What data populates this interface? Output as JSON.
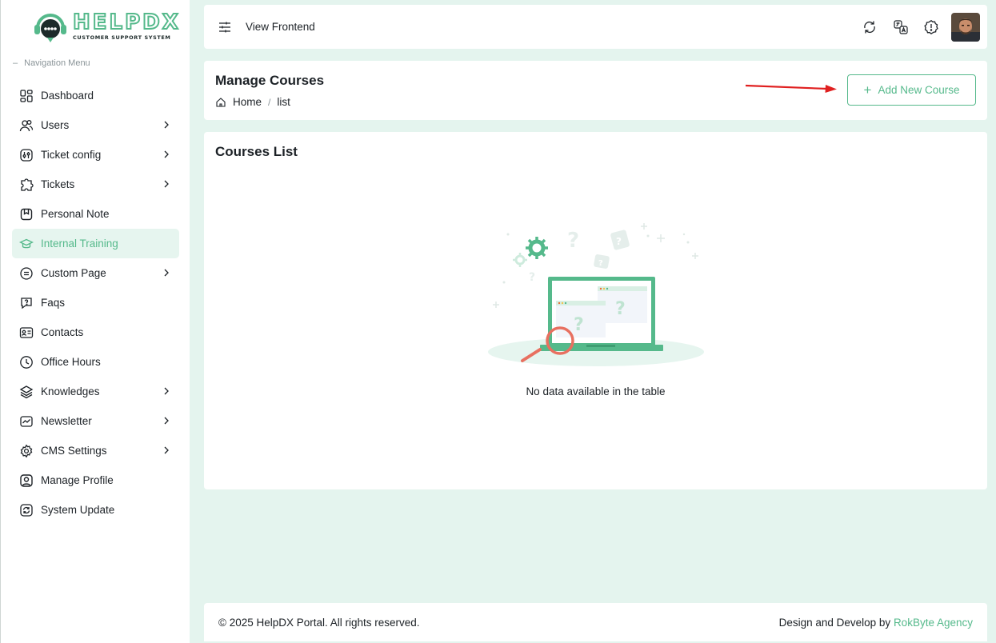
{
  "brand": {
    "name": "HELPDX",
    "tagline": "CUSTOMER SUPPORT SYSTEM",
    "accent_color": "#55b98b"
  },
  "sidebar": {
    "heading": "Navigation Menu",
    "items": [
      {
        "label": "Dashboard",
        "icon": "dashboard-icon",
        "has_submenu": false,
        "active": false
      },
      {
        "label": "Users",
        "icon": "users-icon",
        "has_submenu": true,
        "active": false
      },
      {
        "label": "Ticket config",
        "icon": "ticket-config-icon",
        "has_submenu": true,
        "active": false
      },
      {
        "label": "Tickets",
        "icon": "tickets-icon",
        "has_submenu": true,
        "active": false
      },
      {
        "label": "Personal Note",
        "icon": "note-icon",
        "has_submenu": false,
        "active": false
      },
      {
        "label": "Internal Training",
        "icon": "graduation-cap-icon",
        "has_submenu": false,
        "active": true
      },
      {
        "label": "Custom Page",
        "icon": "page-icon",
        "has_submenu": true,
        "active": false
      },
      {
        "label": "Faqs",
        "icon": "faq-icon",
        "has_submenu": false,
        "active": false
      },
      {
        "label": "Contacts",
        "icon": "contacts-icon",
        "has_submenu": false,
        "active": false
      },
      {
        "label": "Office Hours",
        "icon": "clock-icon",
        "has_submenu": false,
        "active": false
      },
      {
        "label": "Knowledges",
        "icon": "knowledge-icon",
        "has_submenu": true,
        "active": false
      },
      {
        "label": "Newsletter",
        "icon": "newsletter-icon",
        "has_submenu": true,
        "active": false
      },
      {
        "label": "CMS Settings",
        "icon": "gear-icon",
        "has_submenu": true,
        "active": false
      },
      {
        "label": "Manage Profile",
        "icon": "profile-icon",
        "has_submenu": false,
        "active": false
      },
      {
        "label": "System Update",
        "icon": "refresh-icon",
        "has_submenu": false,
        "active": false
      }
    ]
  },
  "topbar": {
    "view_frontend": "View Frontend",
    "icons": [
      "sync-icon",
      "translate-icon",
      "alert-icon"
    ]
  },
  "header": {
    "title": "Manage Courses",
    "breadcrumb": [
      "Home",
      "list"
    ],
    "add_button": "Add New Course"
  },
  "content": {
    "title": "Courses List",
    "empty_message": "No data available in the table"
  },
  "footer": {
    "copyright": "© 2025 HelpDX Portal. All rights reserved.",
    "credit_prefix": "Design and Develop by ",
    "credit_link": "RokByte Agency"
  }
}
